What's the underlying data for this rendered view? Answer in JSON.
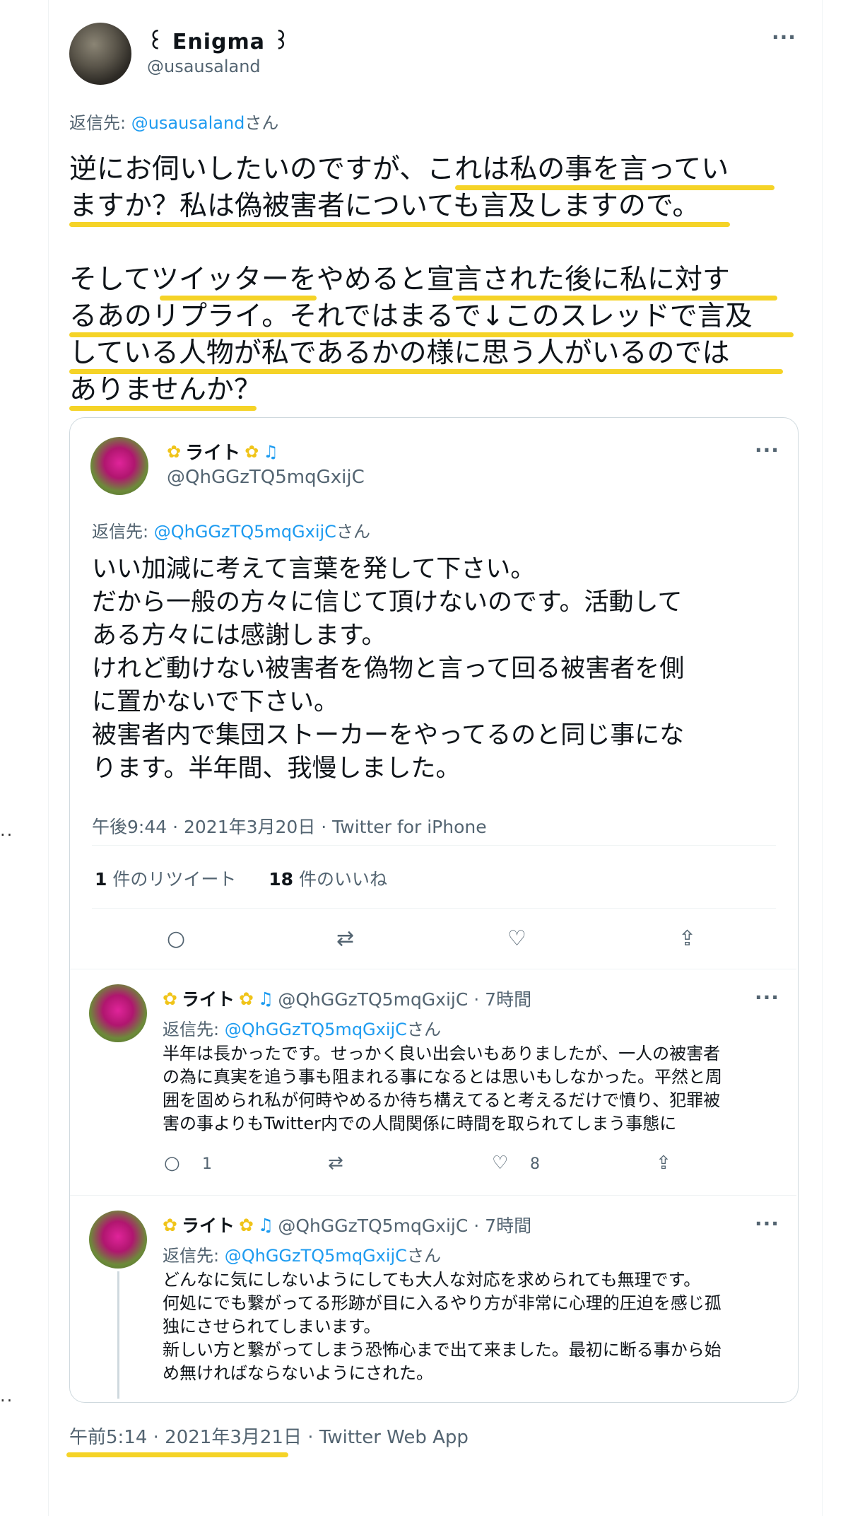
{
  "tweet": {
    "display_name": "꒰ Enigma ꒱",
    "handle": "@usausaland",
    "reply_prefix": "返信先: ",
    "reply_handle": "@usausaland",
    "reply_suffix": "さん",
    "para1": [
      "逆にお伺いしたいのですが、これは私の事を言ってい",
      "ますか？私は偽被害者についても言及しますので。"
    ],
    "para2": [
      "そしてツイッターをやめると宣言された後に私に対す",
      "るあのリプライ。それではまるで↓このスレッドで言及",
      "している人物が私であるかの様に思う人がいるのでは",
      "ありませんか？"
    ],
    "timestamp": "午前5:14 · 2021年3月21日 · Twitter Web App",
    "highlight_color": "#f5d327"
  },
  "quoted": {
    "display_name": "ライト",
    "handle": "@QhGGzTQ5mqGxijC",
    "reply_prefix": "返信先: ",
    "reply_handle": "@QhGGzTQ5mqGxijC",
    "reply_suffix": "さん",
    "lines": [
      "いい加減に考えて言葉を発して下さい。",
      "だから一般の方々に信じて頂けないのです。活動して",
      "ある方々には感謝します。",
      "けれど動けない被害者を偽物と言って回る被害者を側",
      "に置かないで下さい。",
      "被害者内で集団ストーカーをやってるのと同じ事にな",
      "ります。半年間、我慢しました。"
    ],
    "meta": "午後9:44 · 2021年3月20日 · Twitter for iPhone",
    "retweet_count": "1",
    "retweet_label": " 件のリツイート",
    "like_count": "18",
    "like_label": " 件のいいね"
  },
  "replies": [
    {
      "display_name": "ライト",
      "handle": "@QhGGzTQ5mqGxijC · 7時間",
      "reply_prefix": "返信先: ",
      "reply_handle": "@QhGGzTQ5mqGxijC",
      "reply_suffix": "さん",
      "lines": [
        "半年は長かったです。せっかく良い出会いもありましたが、一人の被害者",
        "の為に真実を追う事も阻まれる事になるとは思いもしなかった。平然と周",
        "囲を固められ私が何時やめるか待ち構えてると考えるだけで憤り、犯罪被",
        "害の事よりもTwitter内での人間関係に時間を取られてしまう事態に"
      ],
      "reply_count": "1",
      "like_count": "8"
    },
    {
      "display_name": "ライト",
      "handle": "@QhGGzTQ5mqGxijC · 7時間",
      "reply_prefix": "返信先: ",
      "reply_handle": "@QhGGzTQ5mqGxijC",
      "reply_suffix": "さん",
      "lines": [
        "どんなに気にしないようにしても大人な対応を求められても無理です。",
        "何処にでも繋がってる形跡が目に入るやり方が非常に心理的圧迫を感じ孤",
        "独にさせられてしまいます。",
        "新しい方と繋がってしまう恐怖心まで出て来ました。最初に断る事から始",
        "め無ければならないようにされた。"
      ]
    }
  ],
  "ui": {
    "more": "···",
    "reply_icon": "○",
    "retweet_icon": "⇄",
    "like_icon": "♡",
    "share_icon": "⇪",
    "flower_icon": "✿",
    "music_icon": "♫",
    "stray_marks": ".."
  }
}
